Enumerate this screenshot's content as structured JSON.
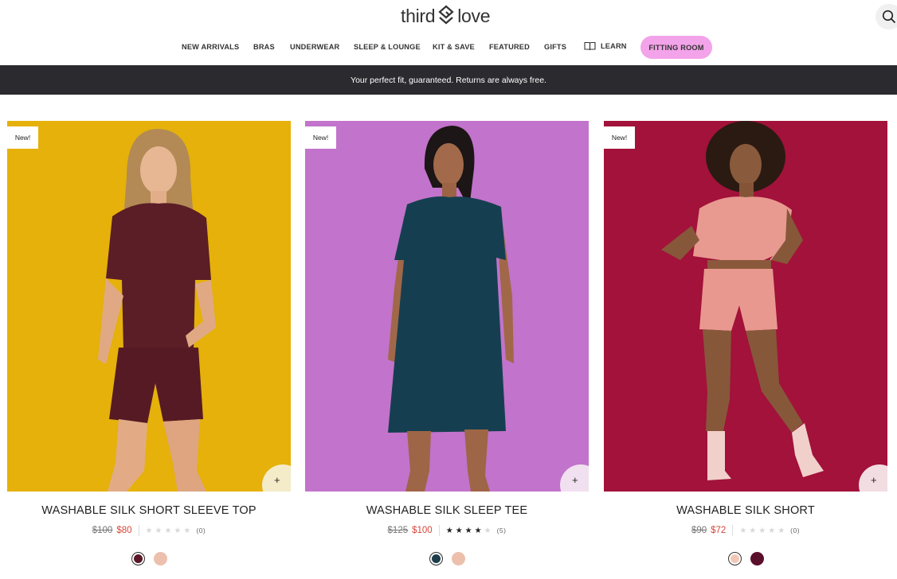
{
  "header": {
    "logo_left": "third",
    "logo_right": "love",
    "nav": [
      {
        "label": "NEW ARRIVALS"
      },
      {
        "label": "BRAS"
      },
      {
        "label": "UNDERWEAR"
      },
      {
        "label": "SLEEP & LOUNGE"
      },
      {
        "label": "KIT & SAVE"
      },
      {
        "label": "FEATURED"
      },
      {
        "label": "GIFTS"
      },
      {
        "label": "LEARN",
        "icon": "book-icon"
      }
    ],
    "fitting_room": "FITTING ROOM",
    "search_icon": "search-icon"
  },
  "banner": {
    "text": "Your perfect fit, guaranteed. Returns are always free."
  },
  "products": [
    {
      "badge": "New!",
      "name": "WASHABLE SILK SHORT SLEEVE TOP",
      "original_price": "$100",
      "sale_price": "$80",
      "rating": 0,
      "review_count": "(0)",
      "quick_add": "+",
      "background": "#e5b10a",
      "quick_add_bg": "#f4ecc8",
      "swatches": [
        {
          "color": "#5a1727",
          "selected": true
        },
        {
          "color": "#ecc0ad",
          "selected": false
        }
      ]
    },
    {
      "badge": "New!",
      "name": "WASHABLE SILK SLEEP TEE",
      "original_price": "$125",
      "sale_price": "$100",
      "rating": 4,
      "review_count": "(5)",
      "quick_add": "+",
      "background": "#c273cb",
      "quick_add_bg": "#f1e0ef",
      "swatches": [
        {
          "color": "#1d3d4a",
          "selected": true
        },
        {
          "color": "#ecc0ad",
          "selected": false
        }
      ]
    },
    {
      "badge": "New!",
      "name": "WASHABLE SILK SHORT",
      "original_price": "$90",
      "sale_price": "$72",
      "rating": 0,
      "review_count": "(0)",
      "quick_add": "+",
      "background": "#a2123a",
      "quick_add_bg": "#f2dde2",
      "swatches": [
        {
          "color": "#f2c7b6",
          "selected": true
        },
        {
          "color": "#5a0f2a",
          "selected": false
        }
      ]
    }
  ]
}
